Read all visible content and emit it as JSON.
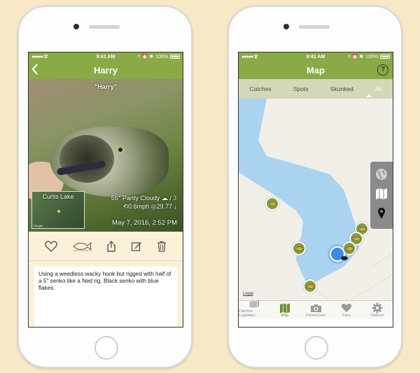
{
  "left_phone": {
    "status": {
      "carrier": "●●●●● ",
      "time": "9:41 AM",
      "icons": "⌾ ⏰ ✱",
      "battery": "100%"
    },
    "nav": {
      "title": "Harry"
    },
    "photo": {
      "caption": "\"Harry\"",
      "map_label": "Curlis Lake",
      "map_google": "Google",
      "weather_line1": "56° Partly Cloudy",
      "weather_line1_icons": "☁ /☽",
      "wind": "0.6mph",
      "pressure": "29.77 ↓",
      "date": "May 7, 2016, 2:52 PM"
    },
    "actions": [
      "favorite-icon",
      "measure-fish-icon",
      "share-icon",
      "edit-icon",
      "delete-icon"
    ],
    "notes": "Using a weedless wacky hook but rigged with half of a 5\" senko like a Ned rig. Black senko with blue flakes."
  },
  "right_phone": {
    "status": {
      "carrier": "●●●●● ",
      "time": "9:41 AM",
      "icons": "⌾ ⏰ ✱",
      "battery": "100%"
    },
    "nav": {
      "title": "Map",
      "help": "?"
    },
    "segments": [
      {
        "label": "Catches",
        "active": false
      },
      {
        "label": "Spots",
        "active": false
      },
      {
        "label": "Skunked",
        "active": false
      },
      {
        "label": "All",
        "active": true
      }
    ],
    "map": {
      "legal": "Legal"
    },
    "tabs": [
      {
        "label": "Catches Log(date)",
        "icon": "catches-log-icon",
        "active": false
      },
      {
        "label": "Map",
        "icon": "map-icon",
        "active": true
      },
      {
        "label": "FisheeCam",
        "icon": "camera-icon",
        "active": false
      },
      {
        "label": "Favs",
        "icon": "heart-icon",
        "active": false
      },
      {
        "label": "Options",
        "icon": "gear-icon",
        "active": false
      }
    ]
  },
  "colors": {
    "brand": "#8aaa46",
    "background": "#f7e8c6",
    "water": "#a9d3ef",
    "segbar": "#d4d7b9"
  }
}
